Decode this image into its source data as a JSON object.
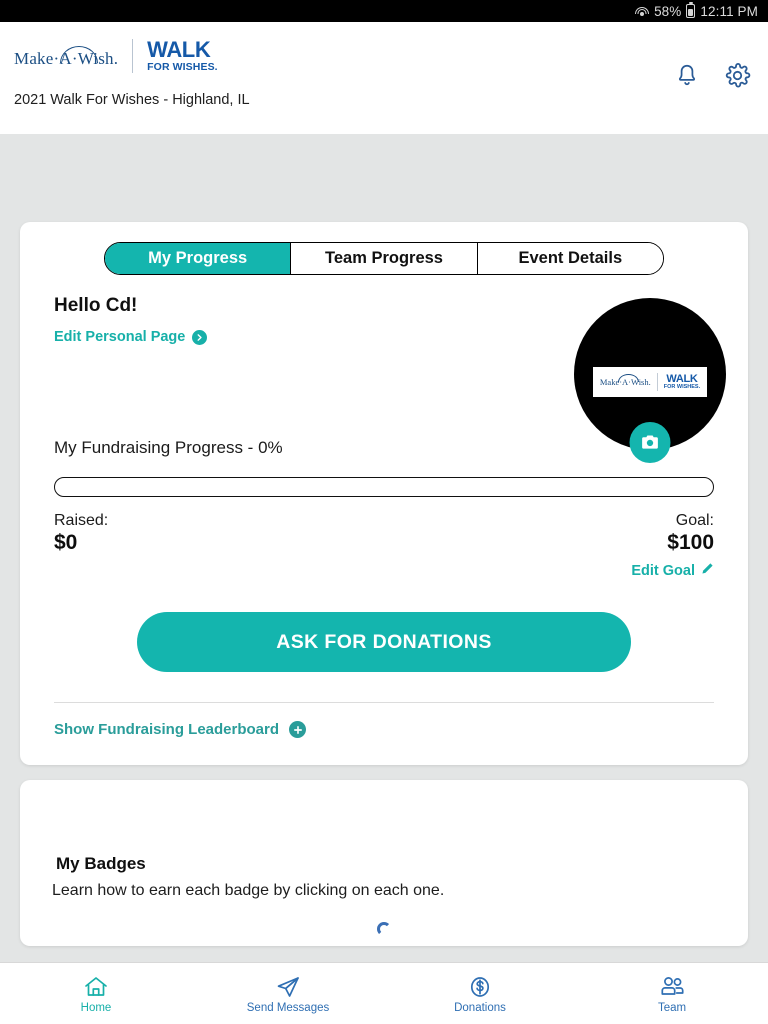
{
  "status_bar": {
    "wifi_icon": "wifi-icon",
    "battery_percent": "58%",
    "battery_icon": "battery-icon",
    "time": "12:11 PM"
  },
  "header": {
    "logo": {
      "make_a_wish": "Make·A·Wish.",
      "walk_line1": "WALK",
      "walk_line2": "FOR WISHES."
    },
    "notification_icon": "bell-icon",
    "settings_icon": "gear-icon",
    "event_name": "2021 Walk For Wishes - Highland, IL"
  },
  "tabs": [
    {
      "label": "My Progress",
      "active": true
    },
    {
      "label": "Team Progress",
      "active": false
    },
    {
      "label": "Event Details",
      "active": false
    }
  ],
  "profile": {
    "greeting": "Hello Cd!",
    "edit_personal_page": "Edit Personal Page",
    "edit_personal_page_icon": "arrow-right-circle-icon",
    "avatar_icon": "avatar",
    "camera_button_icon": "camera-icon"
  },
  "progress": {
    "title": "My Fundraising Progress - 0%",
    "percent": 0,
    "raised_label": "Raised:",
    "raised_value": "$0",
    "goal_label": "Goal:",
    "goal_value": "$100",
    "edit_goal": "Edit Goal",
    "edit_goal_icon": "pencil-icon"
  },
  "cta": {
    "ask_for_donations": "ASK FOR DONATIONS"
  },
  "leaderboard": {
    "label": "Show Fundraising Leaderboard",
    "icon": "plus-circle-icon"
  },
  "badges": {
    "title": "My Badges",
    "description": "Learn how to earn each badge by clicking on each one.",
    "loading_icon": "loading-spinner-icon"
  },
  "bottom_nav": [
    {
      "label": "Home",
      "icon": "home-icon",
      "active": true
    },
    {
      "label": "Send Messages",
      "icon": "paper-plane-icon",
      "active": false
    },
    {
      "label": "Donations",
      "icon": "dollar-circle-icon",
      "active": false
    },
    {
      "label": "Team",
      "icon": "people-icon",
      "active": false
    }
  ],
  "colors": {
    "teal": "#14b5ae",
    "blue": "#1559a8",
    "page_bg": "#e3e5e5"
  }
}
